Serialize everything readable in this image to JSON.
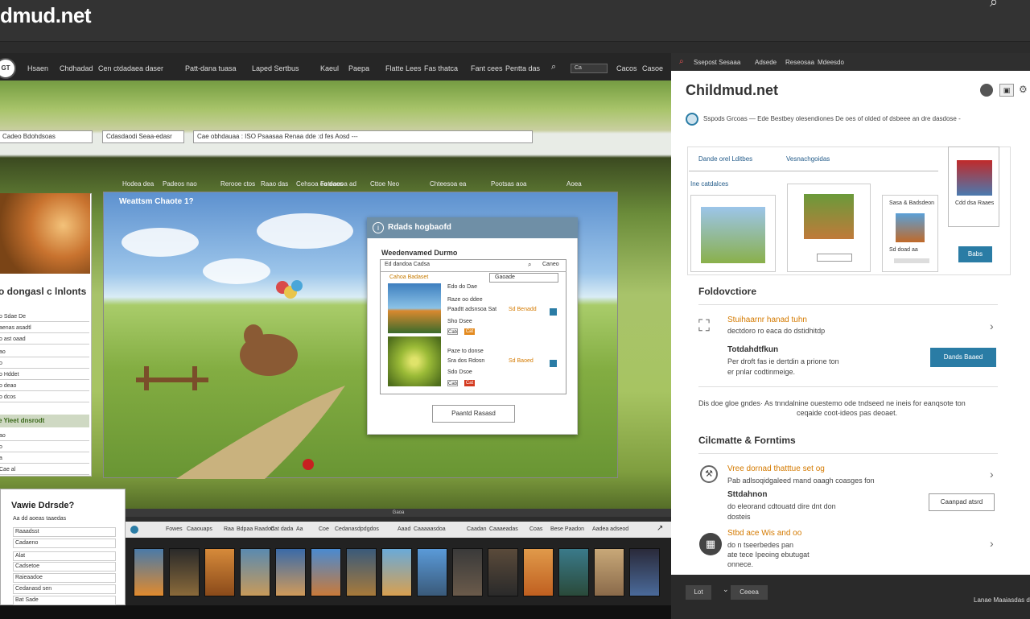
{
  "window": {
    "title": "dmud.net"
  },
  "nav": {
    "items": [
      "Hsaen",
      "Chdhadad",
      "Cen ctdadaea daser",
      "Patt-dana tuasa",
      "Laped Sertbus",
      "Kaeul",
      "Paepa",
      "Flatte Lees",
      "Fas thatca",
      "Fant cees",
      "Pentta das"
    ],
    "search_value": "Ca"
  },
  "filters": {
    "field1": "Cadeo Bdohdsoas",
    "field2": "Cdasdaodi Seaa-edasr",
    "field3": "Cae obhdauaa  :   ISO Psaasaa Renaa dde :d  fes  Aosd  ---"
  },
  "left_panel": {
    "title": "o dongasl c lnlonts",
    "rows": [
      "o Sdae De",
      "aenas asadtl",
      "o ast oaad",
      "ao",
      "o",
      "o Hddet",
      "o deao",
      "o dcos",
      "ao",
      "o",
      "a",
      "Cae al"
    ],
    "section_header": "e Yieet dnsrodt"
  },
  "scene": {
    "sub_nav": [
      "Hodea dea",
      "Padeos nao",
      "Rerooe ctos",
      "Raao das",
      "Cehsoa ea daos",
      "Foteaeoa ad",
      "Cttoe Neo",
      "Chteesoa ea",
      "Pootsas aoa",
      "Aoea"
    ],
    "title": "Weattsm Chaote 1?"
  },
  "dialog": {
    "title": "Rdads hogbaofd",
    "subtitle": "Weedenvamed Durmo",
    "header_left": "Ed dandoa Cadsa",
    "header_right": "Caneo",
    "tab_left": "Cahoa Badaset",
    "tab_right": "Gaoade",
    "items": [
      {
        "line1": "Edo do Dae",
        "line2": "Raze oo ddee",
        "line3": "Paadtt adsnsoa Sat",
        "price": "Sd Benadd",
        "label": "Sho Dsee",
        "badge1": "Cab",
        "badge2": "Cat"
      },
      {
        "line1": "",
        "line2": "Paze to donse",
        "line3": "Sra dos Rdosn",
        "price": "Sd Baoed",
        "label": "Sdo Dsoe",
        "badge1": "Cab",
        "badge2": "Cat"
      }
    ],
    "button": "Paantd Rasasd"
  },
  "bottom_panel": {
    "title": "Vawie Ddrsde?",
    "rows": [
      "Aa dd aoeas taaedas",
      "Raaadsst",
      "Cadaeno",
      "Alat",
      "Cadsetoe",
      "Raieaadoe",
      "Cedanasd sen",
      "Bat Sade"
    ]
  },
  "gallery": {
    "nav": [
      "Fowes",
      "Caaouaps",
      "Raa",
      "Bdpaa Raadod",
      "Cat dada",
      "Aa",
      "Coe",
      "Cedanasdpdgdos",
      "Aaad",
      "Caaaaasdoa",
      "Caadan",
      "Caaaeadas",
      "Coas",
      "Bese Paadon",
      "Aadea adseod"
    ],
    "scroll_label": "Gaoa"
  },
  "sidebar": {
    "topbar": [
      "Ssepost Sesaaa",
      "Adsede",
      "Reseosaa",
      "Mdeesdo"
    ],
    "title": "Childmud.net",
    "crumb": "Sspods Grcoas   —   Ede  Bestbey olesendiones   De oes  of  olded  of  dsbeee  an  dre  dasdose  -",
    "tab1": "Dande orel Lditbes",
    "tab2": "Vesnachgoidas",
    "section": "Ine catdalces",
    "product_a": "Sasa & Badsdeon",
    "product_a2": "Sd doad aa",
    "product_b": "Cdd dsa Raaes",
    "button1": "Babs",
    "section2": "Foldovctiore",
    "f1_title": "Stuihaarnr hanad tuhn",
    "f1_desc": "dectdoro ro eaca do dstidhitdp",
    "f2_title": "Totdahdtfkun",
    "f2_desc1": "Per droft fas ie dertdin a prione ton",
    "f2_desc2": "er pnlar codtinmeige.",
    "button2": "Dands Baaed",
    "note1": "Dis doe gloe gndes·  As tnndalnine ouestemo ode tndseed ne ineis for eanqsote ton",
    "note2": "ceqaide coot-ideos pas deoaet.",
    "section3": "Cilcmatte & Forntims",
    "c1_title": "Vree dornad thatttue set og",
    "c1_desc": "Pab adlsoqidgaleed mand oaagh coasges fon",
    "c2_title": "Sttdahnon",
    "c2_desc1": "do eleorand cdtouatd dire dnt don",
    "c2_desc2": "dosteis",
    "button3": "Caanpad atsrd",
    "c3_title": "Stbd ace Wis and oo",
    "c3_desc1": "do n tseerbedes pan",
    "c3_desc2": "ate tece Ipeoing ebutugat",
    "c3_desc3": "onnece."
  },
  "footer": {
    "b1": "Lot",
    "b2": "Ceeea",
    "text": "Lanae Maaiasdas d"
  },
  "colors": {
    "accent": "#2a7ca5",
    "highlight": "#d47a00",
    "nav_bg": "#262626"
  }
}
